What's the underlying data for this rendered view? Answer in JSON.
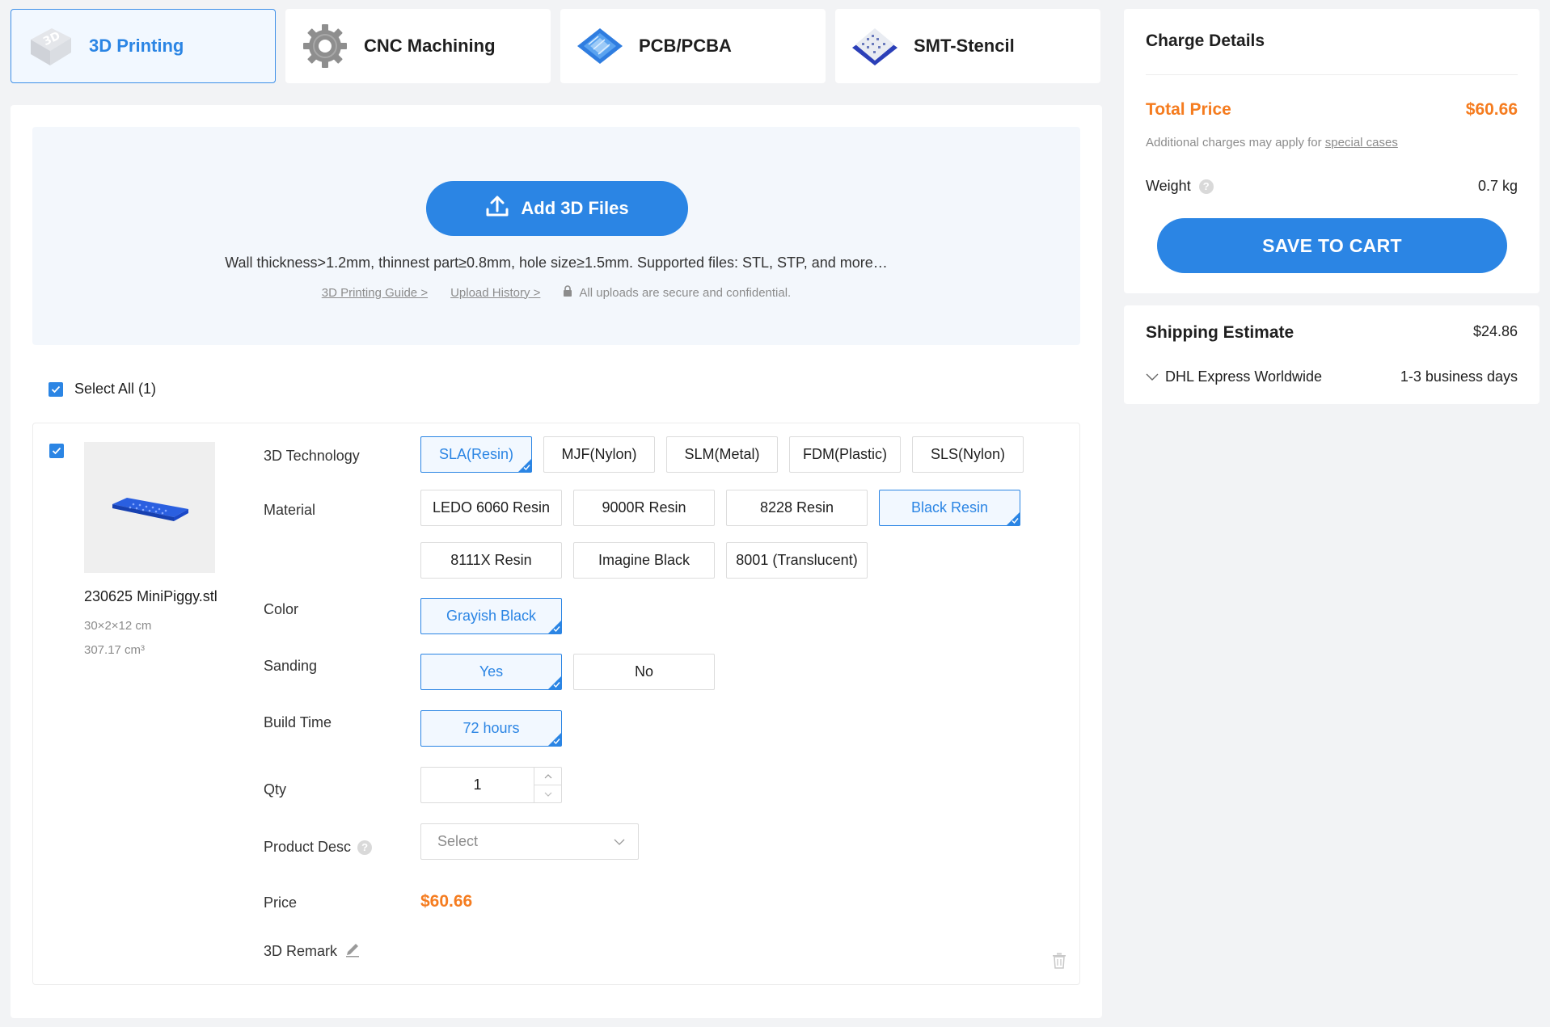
{
  "tabs": [
    {
      "label": "3D Printing",
      "icon": "3d-printing-icon",
      "active": true
    },
    {
      "label": "CNC Machining",
      "icon": "gear-icon",
      "active": false
    },
    {
      "label": "PCB/PCBA",
      "icon": "pcb-icon",
      "active": false
    },
    {
      "label": "SMT-Stencil",
      "icon": "stencil-icon",
      "active": false
    }
  ],
  "upload": {
    "button_label": "Add 3D Files",
    "hint": "Wall thickness>1.2mm, thinnest part≥0.8mm, hole size≥1.5mm. Supported files: STL, STP, and more…",
    "guide_link": "3D Printing Guide >",
    "history_link": "Upload History >",
    "secure_text": "All uploads are secure and confidential."
  },
  "select_all_label": "Select All (1)",
  "item": {
    "file_name": "230625 MiniPiggy.stl",
    "dimensions": "30×2×12 cm",
    "volume": "307.17 cm³",
    "technology": {
      "label": "3D Technology",
      "options": [
        "SLA(Resin)",
        "MJF(Nylon)",
        "SLM(Metal)",
        "FDM(Plastic)",
        "SLS(Nylon)"
      ],
      "selected": "SLA(Resin)"
    },
    "material": {
      "label": "Material",
      "options": [
        "LEDO 6060 Resin",
        "9000R Resin",
        "8228 Resin",
        "Black Resin",
        "8111X Resin",
        "Imagine Black",
        "8001 (Translucent)"
      ],
      "selected": "Black Resin"
    },
    "color": {
      "label": "Color",
      "options": [
        "Grayish Black"
      ],
      "selected": "Grayish Black"
    },
    "sanding": {
      "label": "Sanding",
      "options": [
        "Yes",
        "No"
      ],
      "selected": "Yes"
    },
    "build_time": {
      "label": "Build Time",
      "options": [
        "72 hours"
      ],
      "selected": "72 hours"
    },
    "qty": {
      "label": "Qty",
      "value": "1"
    },
    "product_desc": {
      "label": "Product Desc",
      "placeholder": "Select"
    },
    "price": {
      "label": "Price",
      "value": "$60.66"
    },
    "remark": {
      "label": "3D Remark"
    }
  },
  "charge": {
    "title": "Charge Details",
    "total_label": "Total Price",
    "total_value": "$60.66",
    "note_prefix": "Additional charges may apply for",
    "note_link": "special cases",
    "weight_label": "Weight",
    "weight_value": "0.7 kg",
    "save_label": "SAVE TO CART"
  },
  "shipping": {
    "title": "Shipping Estimate",
    "value": "$24.86",
    "method": "DHL Express Worldwide",
    "days": "1-3 business days"
  },
  "colors": {
    "accent": "#2b85e4",
    "price": "#f57c1f"
  }
}
